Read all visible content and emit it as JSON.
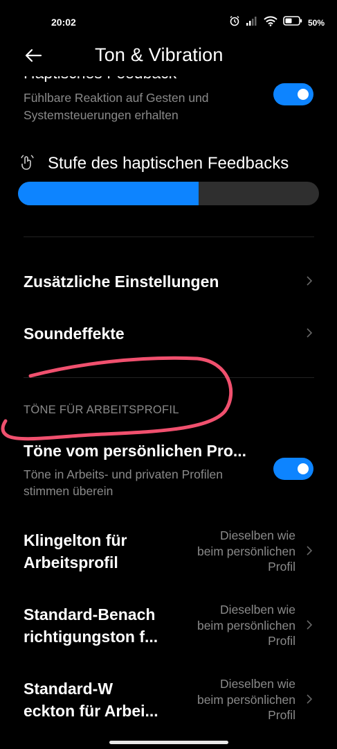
{
  "status_bar": {
    "time": "20:02",
    "battery_percent": "50%",
    "icons": [
      "alarm-icon",
      "signal-icon",
      "wifi-icon",
      "battery-icon"
    ]
  },
  "header": {
    "title": "Ton & Vibration",
    "back_icon": "arrow-left-icon"
  },
  "haptic": {
    "title": "Haptisches Feedback",
    "subtitle_line1": "Fühlbare Reaktion auf Gesten und",
    "subtitle_line2": "Systemsteuerungen erhalten",
    "enabled": true
  },
  "haptic_level": {
    "label": "Stufe des haptischen Feedbacks",
    "icon": "vibration-hand-icon",
    "level_fraction": 0.6
  },
  "menu": {
    "additional_settings": "Zusätzliche Einstellungen",
    "sound_effects": "Soundeffekte"
  },
  "work_profile": {
    "section_title": "TÖNE FÜR ARBEITSPROFIL",
    "personal_tones": {
      "title": "Töne vom persönlichen Pro...",
      "subtitle_line1": "Töne in Arbeits- und privaten Profilen",
      "subtitle_line2": "stimmen überein",
      "enabled": true
    },
    "ringtone": {
      "title_line1": "Klingelton für",
      "title_line2": "Arbeitsprofil",
      "value_line1": "Dieselben wie",
      "value_line2": "beim persönlichen",
      "value_line3": "Profil"
    },
    "notification": {
      "title_line1": "Standard-Benach",
      "title_line2": "richtigungston f...",
      "value_line1": "Dieselben wie",
      "value_line2": "beim persönlichen",
      "value_line3": "Profil"
    },
    "alarm": {
      "title_line1": "Standard-W",
      "title_line2": "eckton für Arbei...",
      "value_line1": "Dieselben wie",
      "value_line2": "beim persönlichen",
      "value_line3": "Profil"
    }
  },
  "colors": {
    "accent": "#0d84ff",
    "annotation": "#f0506e",
    "background": "#000000"
  }
}
